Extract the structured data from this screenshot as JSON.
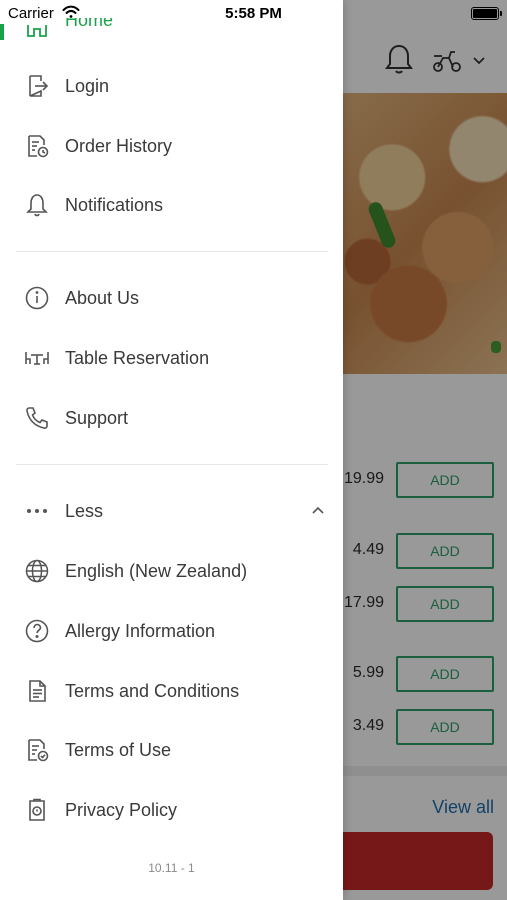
{
  "status_bar": {
    "carrier": "Carrier",
    "time": "5:58 PM"
  },
  "drawer": {
    "home_label": "Home",
    "items": [
      {
        "label": "Login",
        "icon": "login-icon"
      },
      {
        "label": "Order History",
        "icon": "order-history-icon"
      },
      {
        "label": "Notifications",
        "icon": "bell-icon"
      }
    ],
    "info_items": [
      {
        "label": "About Us",
        "icon": "info-icon"
      },
      {
        "label": "Table Reservation",
        "icon": "table-icon"
      },
      {
        "label": "Support",
        "icon": "phone-icon"
      }
    ],
    "more_toggle": {
      "label": "Less",
      "icon": "ellipsis-icon",
      "expanded": true
    },
    "extra_items": [
      {
        "label": "English (New Zealand)",
        "icon": "globe-icon"
      },
      {
        "label": "Allergy Information",
        "icon": "question-icon"
      },
      {
        "label": "Terms and Conditions",
        "icon": "document-icon"
      },
      {
        "label": "Terms of Use",
        "icon": "document-check-icon"
      },
      {
        "label": "Privacy Policy",
        "icon": "privacy-icon"
      }
    ],
    "version": "10.11 - 1",
    "accent_color": "#1aa34a"
  },
  "background": {
    "products": [
      {
        "price": "19.99",
        "add_label": "ADD"
      },
      {
        "price": "4.49",
        "add_label": "ADD"
      },
      {
        "price": "17.99",
        "add_label": "ADD"
      },
      {
        "price": "5.99",
        "add_label": "ADD"
      },
      {
        "price": "3.49",
        "add_label": "ADD"
      }
    ],
    "view_all": "View all",
    "add_color": "#2f9e6a",
    "cta_color": "#c62828"
  }
}
